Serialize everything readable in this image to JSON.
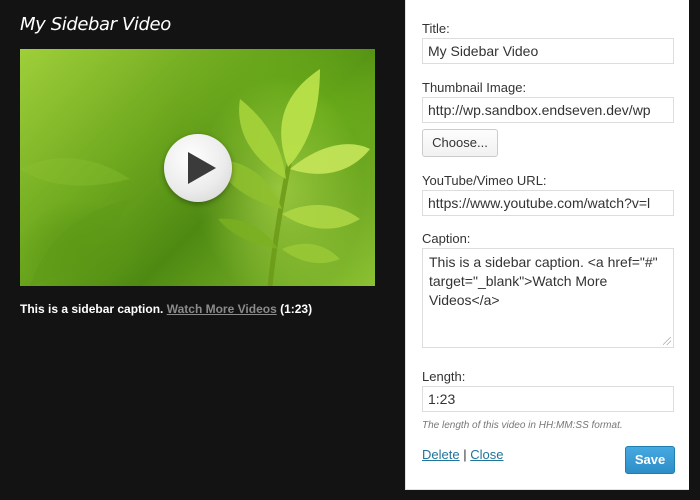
{
  "preview": {
    "title": "My Sidebar Video",
    "play_icon": "play-icon",
    "caption_text": "This is a sidebar caption.",
    "caption_link": "Watch More Videos",
    "caption_length": "(1:23)"
  },
  "form": {
    "title_label": "Title:",
    "title_value": "My Sidebar Video",
    "thumbnail_label": "Thumbnail Image:",
    "thumbnail_value": "http://wp.sandbox.endseven.dev/wp",
    "choose_label": "Choose...",
    "url_label": "YouTube/Vimeo URL:",
    "url_value": "https://www.youtube.com/watch?v=l",
    "caption_label": "Caption:",
    "caption_value": "This is a sidebar caption. <a href=\"#\" target=\"_blank\">Watch More Videos</a>",
    "length_label": "Length:",
    "length_value": "1:23",
    "length_help": "The length of this video in HH:MM:SS format.",
    "delete_label": "Delete",
    "separator": "|",
    "close_label": "Close",
    "save_label": "Save"
  },
  "colors": {
    "background": "#131313",
    "link": "#21759b",
    "save_button": "#2e8fc8"
  }
}
